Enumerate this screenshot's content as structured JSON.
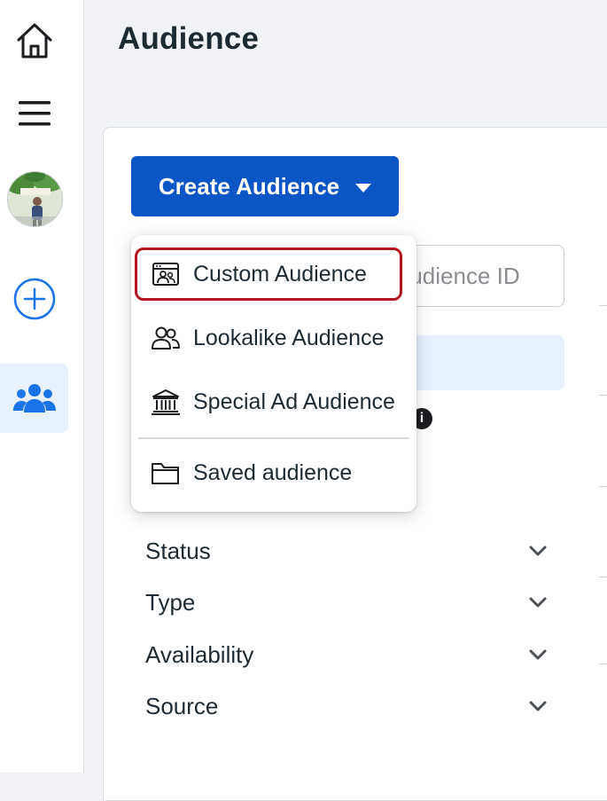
{
  "header": {
    "title": "Audience"
  },
  "sidebar": {
    "items": [
      {
        "name": "home",
        "icon": "home-icon"
      },
      {
        "name": "menu",
        "icon": "hamburger-menu-icon"
      },
      {
        "name": "account-avatar",
        "icon": "avatar"
      },
      {
        "name": "create",
        "icon": "plus-circle-icon"
      },
      {
        "name": "audiences",
        "icon": "people-group-icon",
        "active": true
      }
    ]
  },
  "toolbar": {
    "create_label": "Create Audience",
    "search_placeholder": "Audience ID"
  },
  "dropdown": {
    "items": [
      {
        "label": "Custom Audience",
        "icon": "custom-audience-icon",
        "highlighted": true
      },
      {
        "label": "Lookalike Audience",
        "icon": "lookalike-people-icon"
      },
      {
        "label": "Special Ad Audience",
        "icon": "bank-building-icon"
      },
      {
        "label": "Saved audience",
        "icon": "folder-icon"
      }
    ]
  },
  "filters": [
    {
      "label": "Status"
    },
    {
      "label": "Type"
    },
    {
      "label": "Availability"
    },
    {
      "label": "Source"
    }
  ],
  "colors": {
    "primary": "#0b55c7",
    "highlight_outline": "#b3141f",
    "active_rail_bg": "#e7f0fd",
    "page_bg": "#f0f2f5"
  }
}
